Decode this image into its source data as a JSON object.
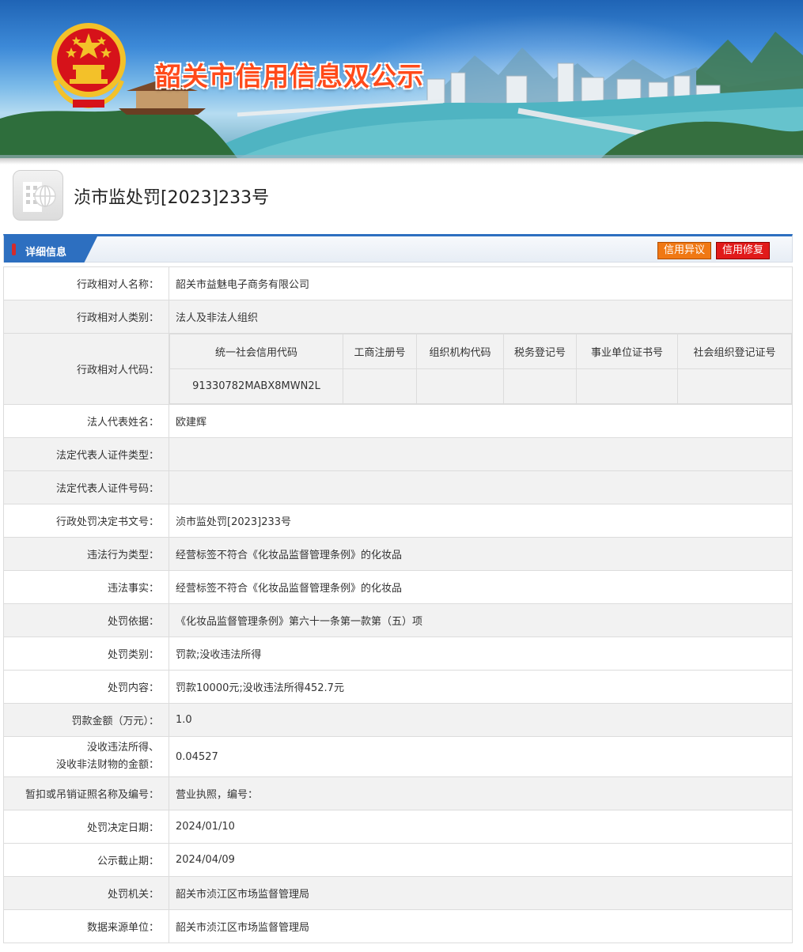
{
  "banner": {
    "title": "韶关市信用信息双公示"
  },
  "doc": {
    "title": "浈市监处罚[2023]233号"
  },
  "section": {
    "tab_label": "详细信息",
    "btn_objection": "信用异议",
    "btn_repair": "信用修复"
  },
  "rows": {
    "name": {
      "label": "行政相对人名称：",
      "value": "韶关市益魅电子商务有限公司"
    },
    "category": {
      "label": "行政相对人类别：",
      "value": "法人及非法人组织"
    },
    "codes": {
      "label": "行政相对人代码：",
      "headers": [
        "统一社会信用代码",
        "工商注册号",
        "组织机构代码",
        "税务登记号",
        "事业单位证书号",
        "社会组织登记证号"
      ],
      "values": [
        "91330782MABX8MWN2L",
        "",
        "",
        "",
        "",
        ""
      ]
    },
    "legal_rep": {
      "label": "法人代表姓名：",
      "value": "欧建辉"
    },
    "id_type": {
      "label": "法定代表人证件类型：",
      "value": ""
    },
    "id_number": {
      "label": "法定代表人证件号码：",
      "value": ""
    },
    "decision_no": {
      "label": "行政处罚决定书文号：",
      "value": "浈市监处罚[2023]233号"
    },
    "violation_type": {
      "label": "违法行为类型：",
      "value": "经营标签不符合《化妆品监督管理条例》的化妆品"
    },
    "violation_fact": {
      "label": "违法事实：",
      "value": "经营标签不符合《化妆品监督管理条例》的化妆品"
    },
    "basis": {
      "label": "处罚依据：",
      "value": "《化妆品监督管理条例》第六十一条第一款第（五）项"
    },
    "penalty_type": {
      "label": "处罚类别：",
      "value": "罚款;没收违法所得"
    },
    "penalty_content": {
      "label": "处罚内容：",
      "value": "罚款10000元;没收违法所得452.7元"
    },
    "fine_amount": {
      "label": "罚款金额（万元）：",
      "value": "1.0"
    },
    "confiscation": {
      "label_line1": "没收违法所得、",
      "label_line2": "没收非法财物的金额：",
      "value": "0.04527"
    },
    "license": {
      "label": "暂扣或吊销证照名称及编号：",
      "value": "营业执照，编号："
    },
    "decision_date": {
      "label": "处罚决定日期：",
      "value": "2024/01/10"
    },
    "publish_deadline": {
      "label": "公示截止期：",
      "value": "2024/04/09"
    },
    "authority": {
      "label": "处罚机关：",
      "value": "韶关市浈江区市场监督管理局"
    },
    "data_source": {
      "label": "数据来源单位：",
      "value": "韶关市浈江区市场监督管理局"
    }
  },
  "colors": {
    "accent": "#2d6fc0",
    "objection": "#f07814",
    "repair": "#e11a1a",
    "title": "#ff4a1a"
  },
  "icons": {
    "doc_icon": "building-globe-icon",
    "emblem": "national-emblem"
  }
}
